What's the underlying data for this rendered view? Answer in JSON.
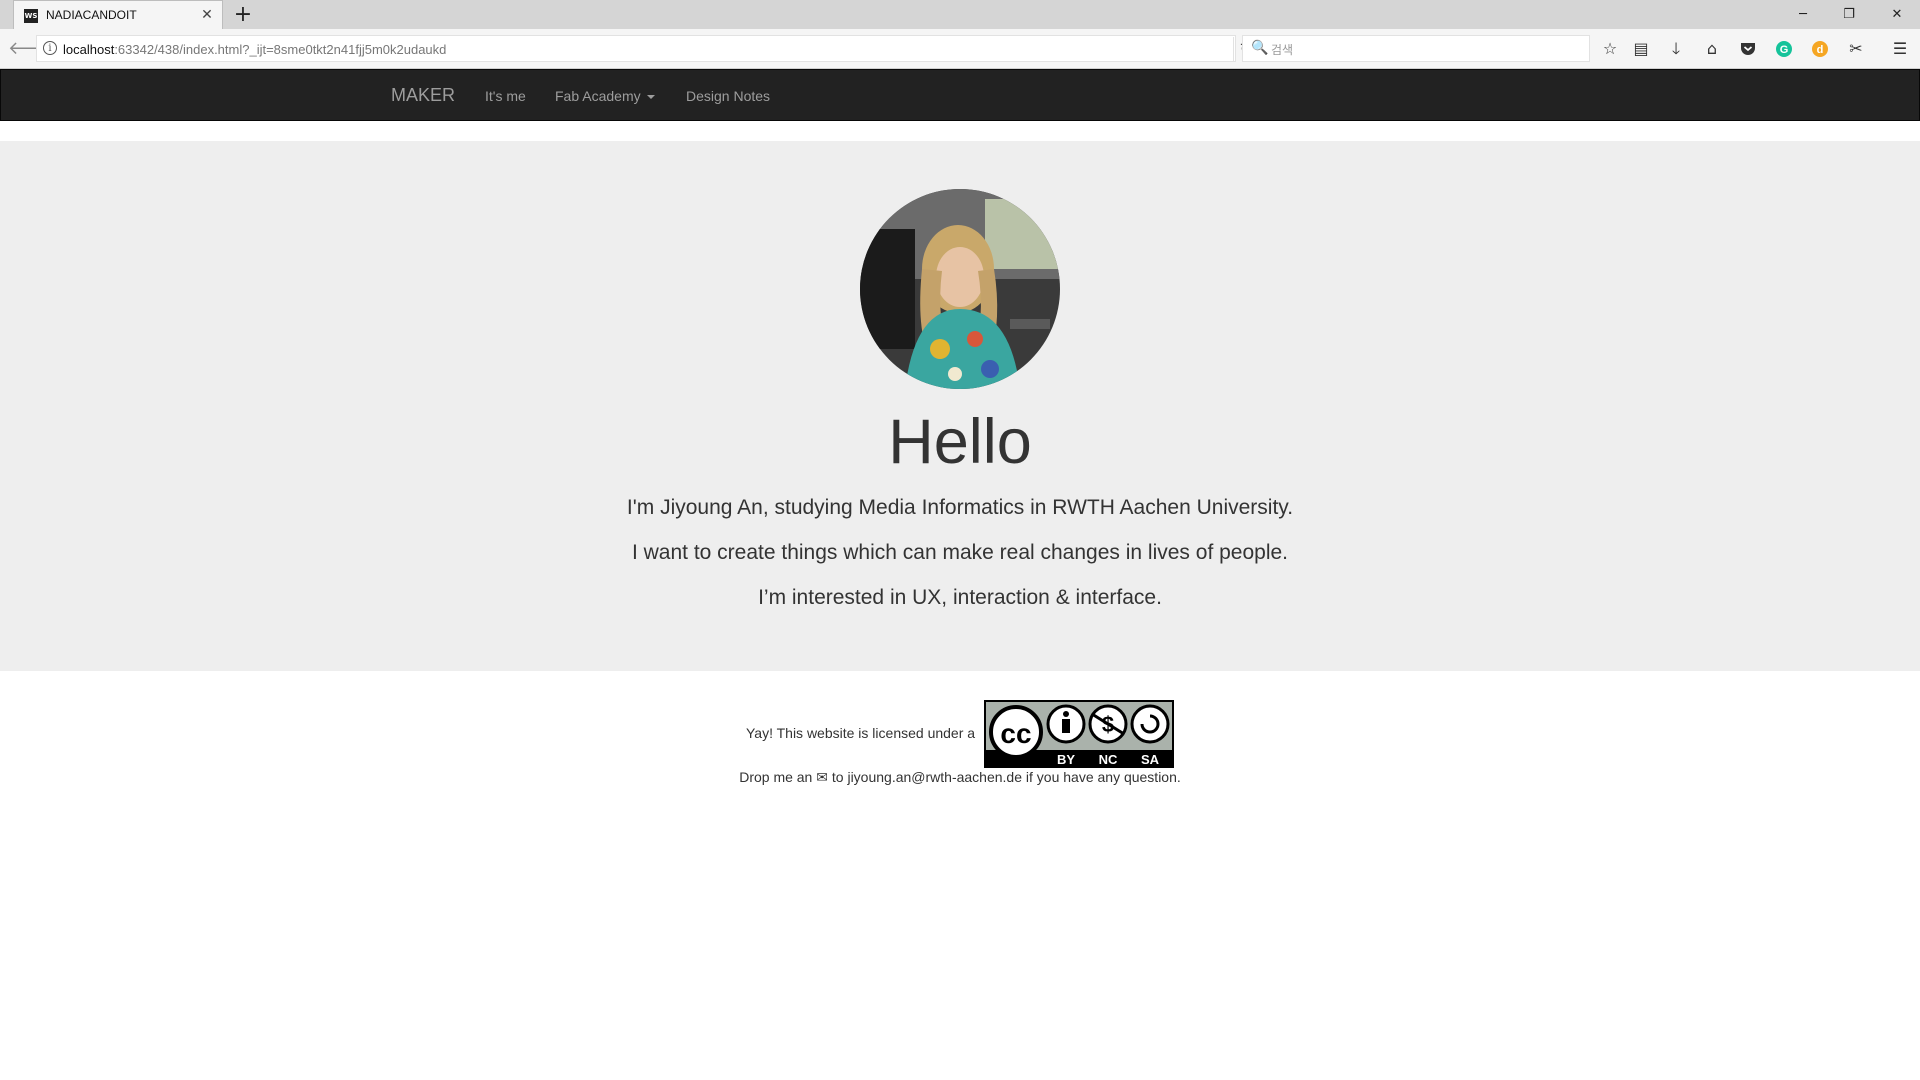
{
  "browser": {
    "tab_title": "NADIACANDOIT",
    "tab_icon": "WS",
    "url_host": "localhost",
    "url_rest": ":63342/438/index.html?_ijt=8sme0tkt2n41fjj5m0k2udaukd",
    "search_placeholder": "검색",
    "close_glyph": "✕",
    "new_tab_glyph": "+",
    "minimize_glyph": "─",
    "maximize_glyph": "❐",
    "window_close_glyph": "✕"
  },
  "navbar": {
    "brand": "MAKER",
    "items": [
      {
        "label": "It's me"
      },
      {
        "label": "Fab Academy",
        "has_dropdown": true
      },
      {
        "label": "Design Notes"
      }
    ]
  },
  "hero": {
    "heading": "Hello",
    "lines": [
      "I'm Jiyoung An, studying Media Informatics in RWTH Aachen University.",
      "I want to create things which can make real changes in lives of people.",
      "I’m interested in UX, interaction & interface."
    ]
  },
  "footer": {
    "license_text": "Yay! This website is licensed under a",
    "badge_labels": [
      "BY",
      "NC",
      "SA"
    ],
    "badge_cc": "cc",
    "contact_prefix": "Drop me an",
    "contact_mid": "to",
    "email": "jiyoung.an@rwth-aachen.de",
    "contact_suffix": "if you have any question."
  },
  "colors": {
    "navbar_bg": "#222222",
    "jumbotron_bg": "#eeeeee",
    "text": "#333333",
    "nav_text": "#9d9d9d"
  }
}
